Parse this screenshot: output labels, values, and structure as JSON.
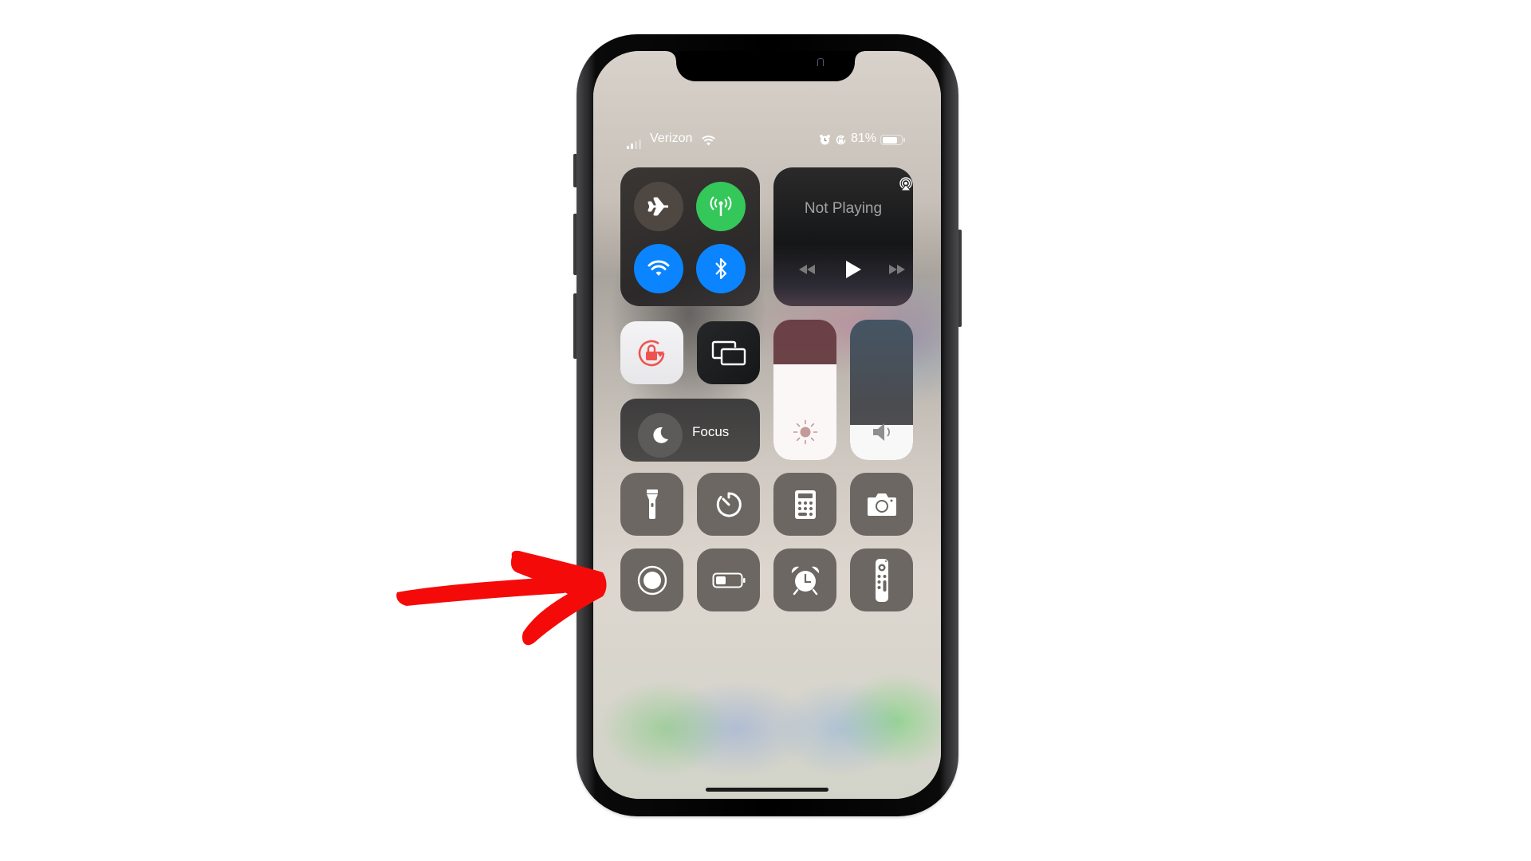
{
  "status_bar": {
    "carrier": "Verizon",
    "signal_bars_active": 2,
    "signal_bars_total": 4,
    "battery_percent": "81%",
    "battery_level": 0.81,
    "icons": [
      "signal-icon",
      "wifi-icon",
      "alarm-icon",
      "rotation-lock-icon",
      "battery-icon"
    ]
  },
  "connectivity": {
    "airplane_mode": {
      "icon": "airplane-icon",
      "enabled": false
    },
    "cellular_data": {
      "icon": "cellular-antenna-icon",
      "enabled": true
    },
    "wifi": {
      "icon": "wifi-icon",
      "enabled": true
    },
    "bluetooth": {
      "icon": "bluetooth-icon",
      "enabled": true
    }
  },
  "now_playing": {
    "title": "Not Playing",
    "controls": [
      "rewind-icon",
      "play-icon",
      "fast-forward-icon"
    ],
    "airplay_icon": "airplay-icon"
  },
  "toggles": {
    "orientation_lock": {
      "icon": "orientation-lock-icon",
      "enabled": true
    },
    "screen_mirroring": {
      "icon": "screen-mirroring-icon"
    },
    "focus": {
      "label": "Focus",
      "icon": "moon-icon"
    }
  },
  "sliders": {
    "brightness": {
      "icon": "sun-icon",
      "level": 0.68
    },
    "volume": {
      "icon": "speaker-icon",
      "level": 0.25
    }
  },
  "shortcuts": [
    {
      "name": "flashlight",
      "icon": "flashlight-icon"
    },
    {
      "name": "timer",
      "icon": "timer-icon"
    },
    {
      "name": "calculator",
      "icon": "calculator-icon"
    },
    {
      "name": "camera",
      "icon": "camera-icon"
    },
    {
      "name": "screen-recording",
      "icon": "screen-record-icon"
    },
    {
      "name": "low-power-mode",
      "icon": "low-battery-icon"
    },
    {
      "name": "alarm",
      "icon": "alarm-clock-icon"
    },
    {
      "name": "apple-tv-remote",
      "icon": "tv-remote-icon"
    }
  ],
  "annotation": {
    "type": "arrow",
    "color": "#f50a0a",
    "points_to": "screen-recording"
  },
  "colors": {
    "cellular_green": "#34c759",
    "system_blue": "#0a84ff",
    "orientation_red": "#ef5350",
    "tile_gray": "#6c6762"
  }
}
